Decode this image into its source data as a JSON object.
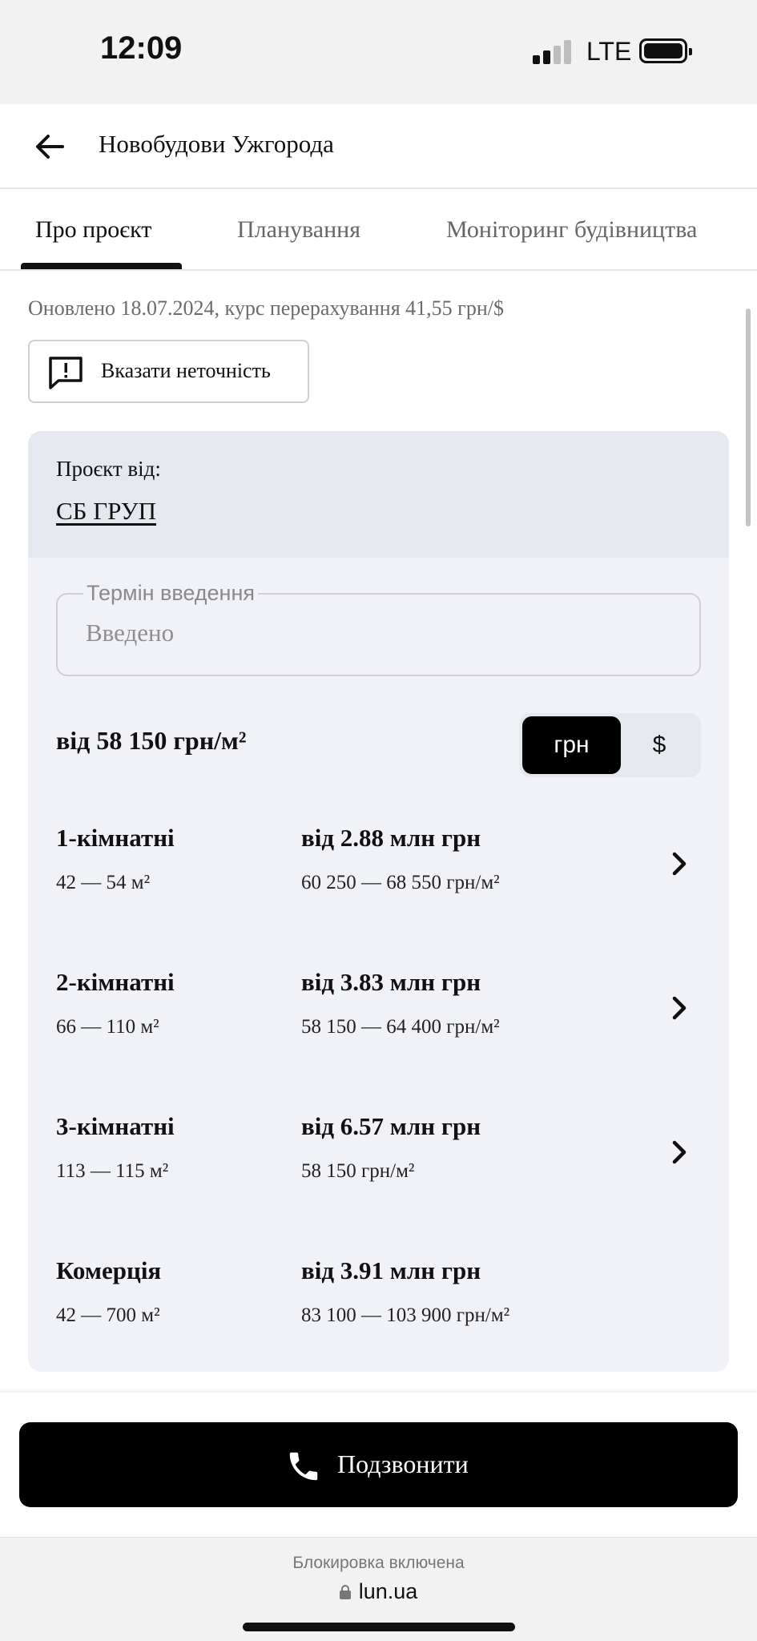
{
  "status_bar": {
    "time": "12:09",
    "network": "LTE",
    "signal_bars": 2
  },
  "header": {
    "title": "Новобудови Ужгорода",
    "back_icon": "arrow-left-icon"
  },
  "tabs": [
    {
      "label": "Про проєкт",
      "active": true
    },
    {
      "label": "Планування",
      "active": false
    },
    {
      "label": "Моніторинг будівництва",
      "active": false
    }
  ],
  "updated_line": "Оновлено 18.07.2024, курс перерахування 41,55 грн/$",
  "report_button": {
    "label": "Вказати неточність",
    "icon": "report-exclamation-icon"
  },
  "developer": {
    "label": "Проєкт від:",
    "name": "СБ ГРУП"
  },
  "completion": {
    "label": "Термін введення",
    "value": "Введено"
  },
  "price_from": "від 58 150 грн/м²",
  "currency": {
    "options": [
      "грн",
      "$"
    ],
    "selected": "грн"
  },
  "apartments": [
    {
      "type": "1-кімнатні",
      "area": "42 — 54 м²",
      "price": "від 2.88 млн грн",
      "price_per_m2": "60 250 — 68 550 грн/м²",
      "has_chevron": true
    },
    {
      "type": "2-кімнатні",
      "area": "66 — 110 м²",
      "price": "від 3.83 млн грн",
      "price_per_m2": "58 150 — 64 400 грн/м²",
      "has_chevron": true
    },
    {
      "type": "3-кімнатні",
      "area": "113 — 115 м²",
      "price": "від 6.57 млн грн",
      "price_per_m2": "58 150 грн/м²",
      "has_chevron": true
    },
    {
      "type": "Комерція",
      "area": "42 — 700 м²",
      "price": "від 3.91 млн грн",
      "price_per_m2": "83 100 — 103 900 грн/м²",
      "has_chevron": false
    }
  ],
  "call_button": {
    "label": "Подзвонити",
    "icon": "phone-icon"
  },
  "browser": {
    "block_note": "Блокировка включена",
    "url": "lun.ua"
  },
  "colors": {
    "primary": "#000000",
    "card_bg": "#f1f2f7",
    "card_header_bg": "#e6e8f0",
    "muted_text": "#6b6b6b"
  }
}
